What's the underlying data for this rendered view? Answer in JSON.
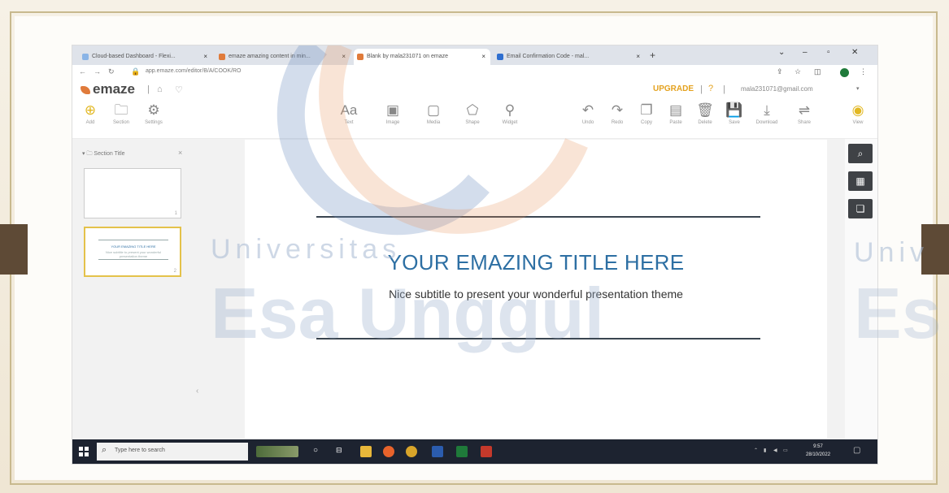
{
  "browser": {
    "tabs": [
      {
        "label": "Cloud-based Dashboard - Flexi..."
      },
      {
        "label": "emaze amazing content in min..."
      },
      {
        "label": "Blank by mala231071 on emaze"
      },
      {
        "label": "Email Confirmation Code - mal..."
      }
    ],
    "url": "app.emaze.com/editor/B/A/COOK/RO"
  },
  "app": {
    "logo": "emaze",
    "upgrade_label": "UPGRADE",
    "help_label": "?",
    "user_email": "mala231071@gmail.com"
  },
  "toolbar": {
    "left": [
      {
        "label": "Add"
      },
      {
        "label": "Section"
      },
      {
        "label": "Settings"
      }
    ],
    "insert": [
      {
        "label": "Text",
        "glyph": "Aa"
      },
      {
        "label": "Image",
        "glyph": "▣"
      },
      {
        "label": "Media",
        "glyph": "▢"
      },
      {
        "label": "Shape",
        "glyph": "⬠"
      },
      {
        "label": "Widget",
        "glyph": "⚲"
      }
    ],
    "actions": [
      {
        "label": "Undo",
        "glyph": "↶"
      },
      {
        "label": "Redo",
        "glyph": "↷"
      },
      {
        "label": "Copy",
        "glyph": "❐"
      },
      {
        "label": "Paste",
        "glyph": "▤"
      },
      {
        "label": "Delete",
        "glyph": "🗑"
      },
      {
        "label": "Save",
        "glyph": "💾"
      },
      {
        "label": "Download",
        "glyph": "⤓"
      },
      {
        "label": "Share",
        "glyph": "⇌"
      },
      {
        "label": "View",
        "glyph": "◉"
      }
    ]
  },
  "leftpanel": {
    "section_title": "Section Title",
    "slide1_number": "1",
    "slide2_number": "2",
    "slide2_title": "YOUR EMAZING TITLE HERE",
    "slide2_sub": "Nice subtitle to present your wonderful presentation theme"
  },
  "slide": {
    "title": "YOUR EMAZING TITLE HERE",
    "subtitle": "Nice subtitle to present your wonderful presentation theme",
    "title_color": "#2d6fa3"
  },
  "watermark": {
    "line1": "Universitas",
    "line2": "Esa Unggul",
    "right_line1": "Univ",
    "right_line2": "Es"
  },
  "taskbar": {
    "search_placeholder": "Type here to search",
    "time": "9:57",
    "date": "28/10/2022"
  },
  "colors": {
    "accent": "#e4a21f",
    "taskbar": "#1d2330",
    "frame_border": "#c8b98e"
  }
}
